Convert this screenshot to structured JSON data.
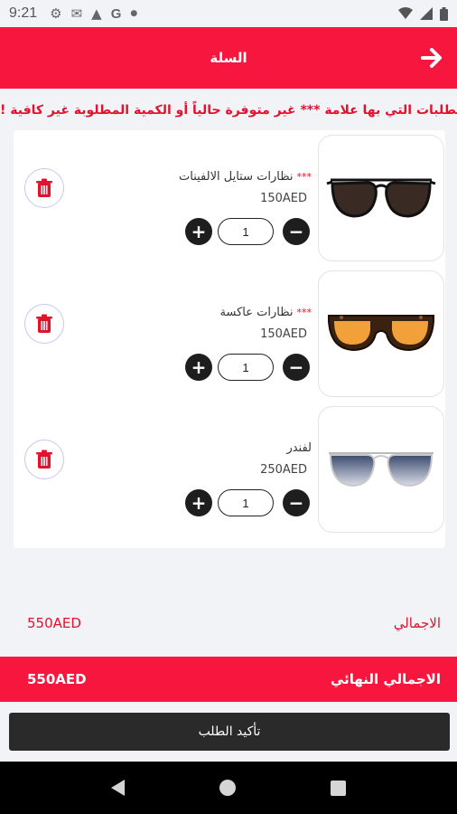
{
  "status_bar": {
    "time": "9:21"
  },
  "header": {
    "title": "السلة"
  },
  "notice": "الطلبات التي بها علامة *** غير متوفرة حالياً أو الكمية المطلوبة غير كافية !",
  "cart": {
    "items": [
      {
        "name": "نظارات ستايل الالفينات",
        "marked": true,
        "stars": "***",
        "price": "150AED",
        "quantity": "1",
        "image": "dark-aviator-sunglasses"
      },
      {
        "name": "نظارات عاكسة",
        "marked": true,
        "stars": "***",
        "price": "150AED",
        "quantity": "1",
        "image": "orange-lens-tortoise-sunglasses"
      },
      {
        "name": "لفندر",
        "marked": false,
        "stars": "",
        "price": "250AED",
        "quantity": "1",
        "image": "silver-aviator-gradient-sunglasses"
      }
    ]
  },
  "totals": {
    "subtotal_label": "الاجمالي",
    "subtotal_value": "550AED",
    "final_label": "الاجمالي النهائي",
    "final_value": "550AED"
  },
  "confirm_button": "تأكيد الطلب",
  "colors": {
    "brand_red": "#f7163e",
    "notice_red": "#e4112d",
    "dark": "#2a2a2a"
  }
}
